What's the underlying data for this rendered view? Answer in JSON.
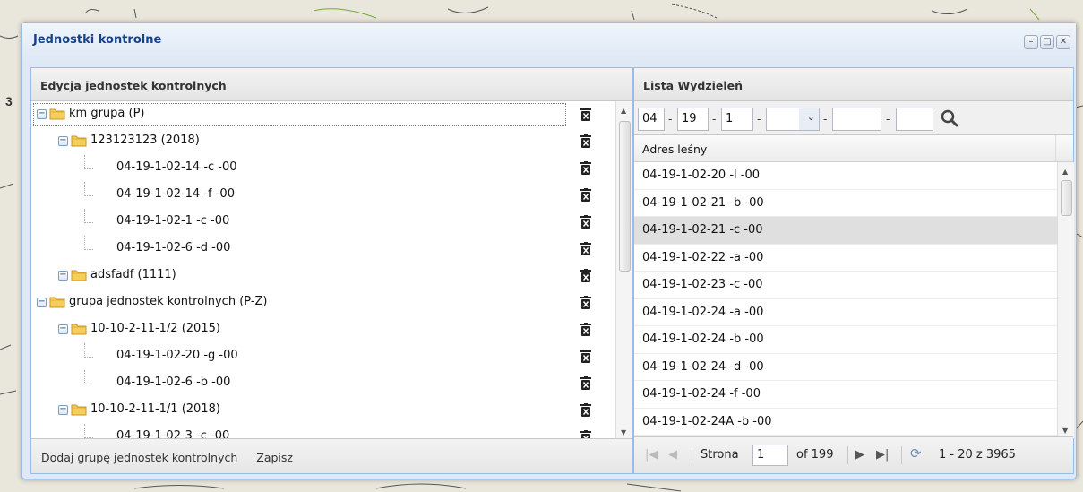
{
  "window": {
    "title": "Jednostki kontrolne",
    "tools": [
      "minimize-icon",
      "maximize-icon",
      "close-icon"
    ]
  },
  "left_panel": {
    "title": "Edycja jednostek kontrolnych",
    "tree": [
      {
        "label": "km grupa (P)",
        "level": 0,
        "type": "folder",
        "selected": true
      },
      {
        "label": "123123123 (2018)",
        "level": 1,
        "type": "folder"
      },
      {
        "label": "04-19-1-02-14 -c -00",
        "level": 2,
        "type": "leaf"
      },
      {
        "label": "04-19-1-02-14 -f -00",
        "level": 2,
        "type": "leaf"
      },
      {
        "label": "04-19-1-02-1 -c -00",
        "level": 2,
        "type": "leaf"
      },
      {
        "label": "04-19-1-02-6 -d -00",
        "level": 2,
        "type": "leaf"
      },
      {
        "label": "adsfadf (1111)",
        "level": 1,
        "type": "folder"
      },
      {
        "label": "grupa jednostek kontrolnych (P-Z)",
        "level": 0,
        "type": "folder"
      },
      {
        "label": "10-10-2-11-1/2 (2015)",
        "level": 1,
        "type": "folder"
      },
      {
        "label": "04-19-1-02-20 -g -00",
        "level": 2,
        "type": "leaf"
      },
      {
        "label": "04-19-1-02-6 -b -00",
        "level": 2,
        "type": "leaf"
      },
      {
        "label": "10-10-2-11-1/1 (2018)",
        "level": 1,
        "type": "folder"
      },
      {
        "label": "04-19-1-02-3 -c -00",
        "level": 2,
        "type": "leaf"
      }
    ],
    "footer": {
      "add_group": "Dodaj grupę jednostek kontrolnych",
      "save": "Zapisz"
    }
  },
  "right_panel": {
    "title": "Lista Wydzieleń",
    "filter": {
      "f1": "04",
      "f2": "19",
      "f3": "1",
      "f4": "",
      "f5": "",
      "f6": "",
      "sep": "-"
    },
    "column_header": "Adres leśny",
    "rows": [
      "04-19-1-02-20 -l -00",
      "04-19-1-02-21 -b -00",
      "04-19-1-02-21 -c -00",
      "04-19-1-02-22 -a -00",
      "04-19-1-02-23 -c -00",
      "04-19-1-02-24 -a -00",
      "04-19-1-02-24 -b -00",
      "04-19-1-02-24 -d -00",
      "04-19-1-02-24 -f -00",
      "04-19-1-02-24A -b -00"
    ],
    "highlighted_row": 2,
    "pager": {
      "page_label": "Strona",
      "page_value": "1",
      "of_label": "of 199",
      "summary": "1 - 20 z 3965"
    }
  }
}
